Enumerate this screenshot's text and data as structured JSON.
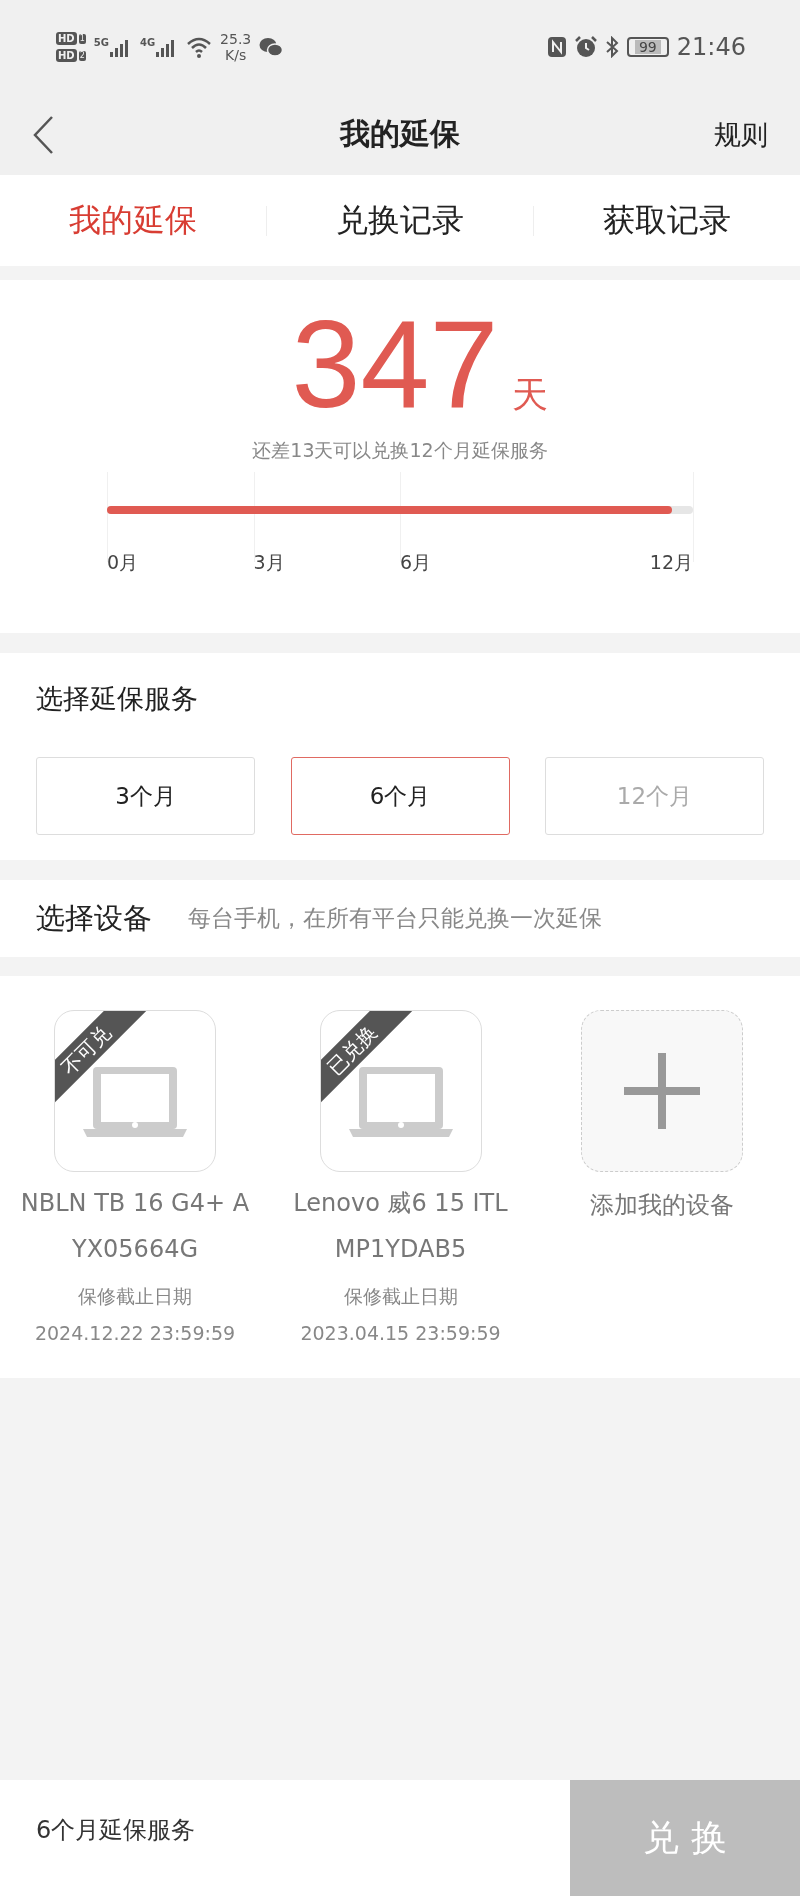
{
  "status_bar": {
    "sims": [
      {
        "badge": "HD",
        "slot": "1"
      },
      {
        "badge": "HD",
        "slot": "2"
      }
    ],
    "networks": [
      "5G",
      "4G"
    ],
    "speed": "25.3",
    "speed_unit": "K/s",
    "battery": "99",
    "time": "21:46"
  },
  "nav": {
    "title": "我的延保",
    "action": "规则"
  },
  "tabs": [
    {
      "label": "我的延保",
      "selected": true
    },
    {
      "label": "兑换记录",
      "selected": false
    },
    {
      "label": "获取记录",
      "selected": false
    }
  ],
  "summary": {
    "days": "347",
    "unit": "天",
    "hint": "还差13天可以兑换12个月延保服务",
    "level": 0.965,
    "ticks": [
      "0月",
      "3月",
      "6月",
      "12月"
    ]
  },
  "service": {
    "title": "选择延保服务",
    "options": [
      {
        "label": "3个月",
        "selected": false,
        "disabled": false
      },
      {
        "label": "6个月",
        "selected": true,
        "disabled": false
      },
      {
        "label": "12个月",
        "selected": false,
        "disabled": true
      }
    ]
  },
  "device_section": {
    "title": "选择设备",
    "note": "每台手机，在所有平台只能兑换一次延保"
  },
  "devices": [
    {
      "kind": "device",
      "badge": "不可兑",
      "name": "NBLN TB 16 G4+ A",
      "serial": "YX05664G",
      "label": "保修截止日期",
      "date": "2024.12.22 23:59:59"
    },
    {
      "kind": "device",
      "badge": "已兑换",
      "name": "Lenovo 威6 15 ITL",
      "serial": "MP1YDAB5",
      "label": "保修截止日期",
      "date": "2023.04.15 23:59:59"
    },
    {
      "kind": "add",
      "name": "添加我的设备"
    }
  ],
  "bottom_bar": {
    "summary": "6个月延保服务",
    "button": "兑 换",
    "disabled": true
  }
}
